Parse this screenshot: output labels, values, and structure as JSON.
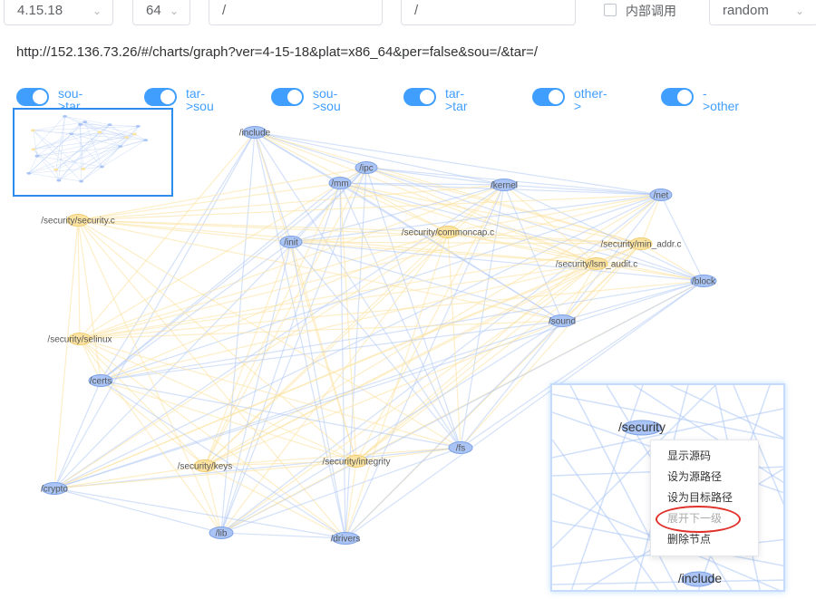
{
  "filters": {
    "version": "4.15.18",
    "platform": "64",
    "source": "/",
    "target": "/",
    "internal_call_label": "内部调用",
    "layout": "random"
  },
  "url": "http://152.136.73.26/#/charts/graph?ver=4-15-18&plat=x86_64&per=false&sou=/&tar=/",
  "toggles": [
    {
      "line1": "sou-",
      "line2": ">tar"
    },
    {
      "line1": "tar-",
      "line2": ">sou"
    },
    {
      "line1": "sou-",
      "line2": ">sou"
    },
    {
      "line1": "tar-",
      "line2": ">tar"
    },
    {
      "line1": "other-",
      "line2": ">"
    },
    {
      "line1": "-",
      "line2": ">other"
    }
  ],
  "colors": {
    "accent": "#409eff",
    "node_blue": "#a9c4f5",
    "node_blue_stroke": "#7fa2e6",
    "node_yellow": "#fbe3a2",
    "node_yellow_stroke": "#f0cd6f",
    "edge_blue": "#a9c4f5",
    "edge_yellow": "#fbe3a2",
    "highlight_ring": "#e0302a"
  },
  "graph": {
    "nodes": [
      {
        "id": "include",
        "label": "/include",
        "kind": "dir"
      },
      {
        "id": "ipc",
        "label": "/ipc",
        "kind": "dir"
      },
      {
        "id": "mm",
        "label": "/mm",
        "kind": "dir"
      },
      {
        "id": "kernel",
        "label": "/kernel",
        "kind": "dir"
      },
      {
        "id": "net",
        "label": "/net",
        "kind": "dir"
      },
      {
        "id": "sec_security_c",
        "label": "/security/security.c",
        "kind": "file"
      },
      {
        "id": "commoncap",
        "label": "/security/commoncap.c",
        "kind": "file"
      },
      {
        "id": "init",
        "label": "/init",
        "kind": "dir"
      },
      {
        "id": "min_addr",
        "label": "/security/min_addr.c",
        "kind": "file"
      },
      {
        "id": "lsm_audit",
        "label": "/security/lsm_audit.c",
        "kind": "file"
      },
      {
        "id": "block",
        "label": "/block",
        "kind": "dir"
      },
      {
        "id": "sound",
        "label": "/sound",
        "kind": "dir"
      },
      {
        "id": "selinux",
        "label": "/security/selinux",
        "kind": "file"
      },
      {
        "id": "certs",
        "label": "/certs",
        "kind": "dir"
      },
      {
        "id": "fs",
        "label": "/fs",
        "kind": "dir"
      },
      {
        "id": "keys",
        "label": "/security/keys",
        "kind": "file"
      },
      {
        "id": "integrity",
        "label": "/security/integrity",
        "kind": "file"
      },
      {
        "id": "crypto",
        "label": "/crypto",
        "kind": "dir"
      },
      {
        "id": "lib",
        "label": "/lib",
        "kind": "dir"
      },
      {
        "id": "drivers",
        "label": "/drivers",
        "kind": "dir"
      }
    ]
  },
  "zoom_panel": {
    "focus_label": "/security",
    "bottom_label": "/include",
    "context_menu": [
      {
        "label": "显示源码",
        "disabled": false
      },
      {
        "label": "设为源路径",
        "disabled": false
      },
      {
        "label": "设为目标路径",
        "disabled": false
      },
      {
        "label": "展开下一级",
        "disabled": true
      },
      {
        "label": "删除节点",
        "disabled": false
      }
    ]
  }
}
